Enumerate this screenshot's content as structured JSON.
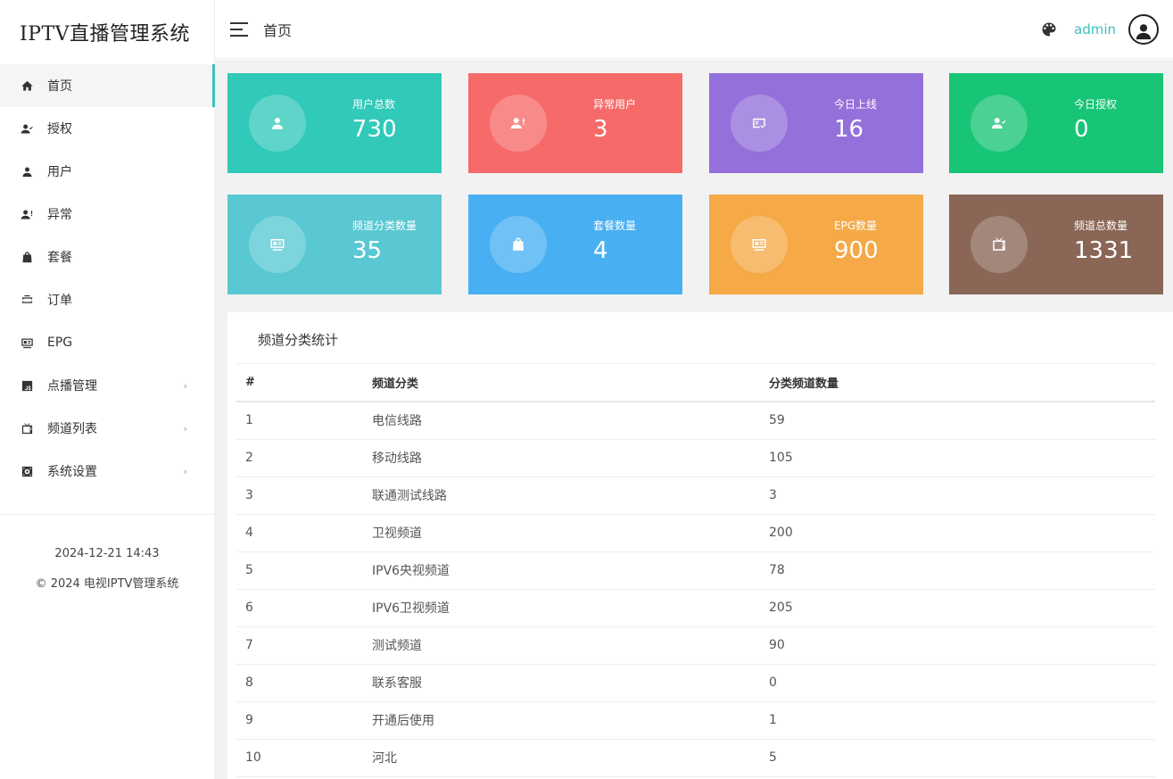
{
  "sidebar": {
    "brand": "IPTV直播管理系统",
    "items": [
      {
        "label": "首页",
        "icon": "home-icon",
        "active": true,
        "arrow": ""
      },
      {
        "label": "授权",
        "icon": "user-check-icon",
        "active": false,
        "arrow": ""
      },
      {
        "label": "用户",
        "icon": "user-icon",
        "active": false,
        "arrow": ""
      },
      {
        "label": "异常",
        "icon": "user-alert-icon",
        "active": false,
        "arrow": ""
      },
      {
        "label": "套餐",
        "icon": "bag-icon",
        "active": false,
        "arrow": ""
      },
      {
        "label": "订单",
        "icon": "order-icon",
        "active": false,
        "arrow": ""
      },
      {
        "label": "EPG",
        "icon": "epg-icon",
        "active": false,
        "arrow": ""
      },
      {
        "label": "点播管理",
        "icon": "js-icon",
        "active": false,
        "arrow": "›"
      },
      {
        "label": "频道列表",
        "icon": "tv-icon",
        "active": false,
        "arrow": "›"
      },
      {
        "label": "系统设置",
        "icon": "settings-icon",
        "active": false,
        "arrow": "›"
      }
    ],
    "footer_datetime": "2024-12-21 14:43",
    "footer_copyright": "© 2024 电视IPTV管理系统"
  },
  "header": {
    "title": "首页",
    "user": "admin",
    "accent_color": "#3cc0bd"
  },
  "stats": [
    {
      "label": "用户总数",
      "value": "730",
      "color": "#31c9b9",
      "icon": "user-icon"
    },
    {
      "label": "异常用户",
      "value": "3",
      "color": "#f66b69",
      "icon": "user-alert-icon"
    },
    {
      "label": "今日上线",
      "value": "16",
      "color": "#9470da",
      "icon": "online-icon"
    },
    {
      "label": "今日授权",
      "value": "0",
      "color": "#18c475",
      "icon": "user-check-icon"
    },
    {
      "label": "频道分类数量",
      "value": "35",
      "color": "#59c8d3",
      "icon": "category-icon"
    },
    {
      "label": "套餐数量",
      "value": "4",
      "color": "#48b0f2",
      "icon": "bag-icon"
    },
    {
      "label": "EPG数量",
      "value": "900",
      "color": "#f5a947",
      "icon": "epg-icon"
    },
    {
      "label": "频道总数量",
      "value": "1331",
      "color": "#8a6656",
      "icon": "tv-icon"
    }
  ],
  "panel": {
    "title": "频道分类统计",
    "columns": [
      "#",
      "频道分类",
      "分类频道数量"
    ],
    "rows": [
      [
        "1",
        "电信线路",
        "59"
      ],
      [
        "2",
        "移动线路",
        "105"
      ],
      [
        "3",
        "联通测试线路",
        "3"
      ],
      [
        "4",
        "卫视频道",
        "200"
      ],
      [
        "5",
        "IPV6央视频道",
        "78"
      ],
      [
        "6",
        "IPV6卫视频道",
        "205"
      ],
      [
        "7",
        "测试频道",
        "90"
      ],
      [
        "8",
        "联系客服",
        "0"
      ],
      [
        "9",
        "开通后使用",
        "1"
      ],
      [
        "10",
        "河北",
        "5"
      ]
    ]
  }
}
